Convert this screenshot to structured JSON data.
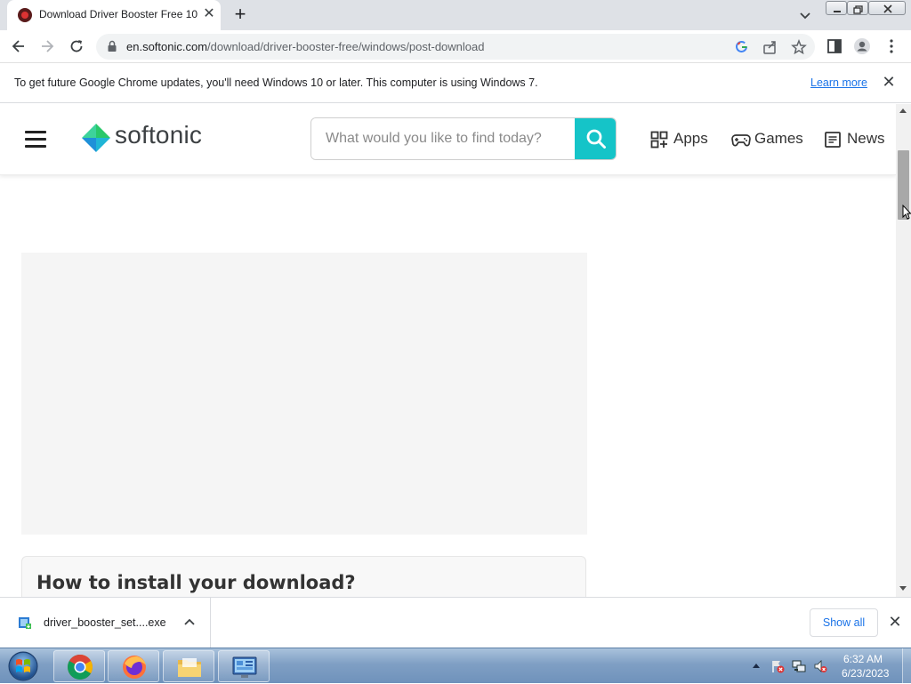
{
  "browser": {
    "tab_title": "Download Driver Booster Free 10",
    "tab_close": "✕",
    "new_tab": "+",
    "url_host": "en.softonic.com",
    "url_path": "/download/driver-booster-free/windows/post-download"
  },
  "infobar": {
    "message": "To get future Google Chrome updates, you'll need Windows 10 or later. This computer is using Windows 7.",
    "learn_more": "Learn more",
    "close": "✕"
  },
  "site": {
    "logo_text": "softonic",
    "search_placeholder": "What would you like to find today?",
    "nav": {
      "apps": "Apps",
      "games": "Games",
      "news": "News"
    },
    "install_heading": "How to install your download?",
    "brand_color": "#15c4c8"
  },
  "download_shelf": {
    "file_name": "driver_booster_set....exe",
    "show_all": "Show all",
    "close": "✕"
  },
  "taskbar": {
    "time": "6:32 AM",
    "date": "6/23/2023",
    "apps": [
      "chrome-icon",
      "firefox-icon",
      "file-explorer-icon",
      "control-panel-icon"
    ]
  }
}
